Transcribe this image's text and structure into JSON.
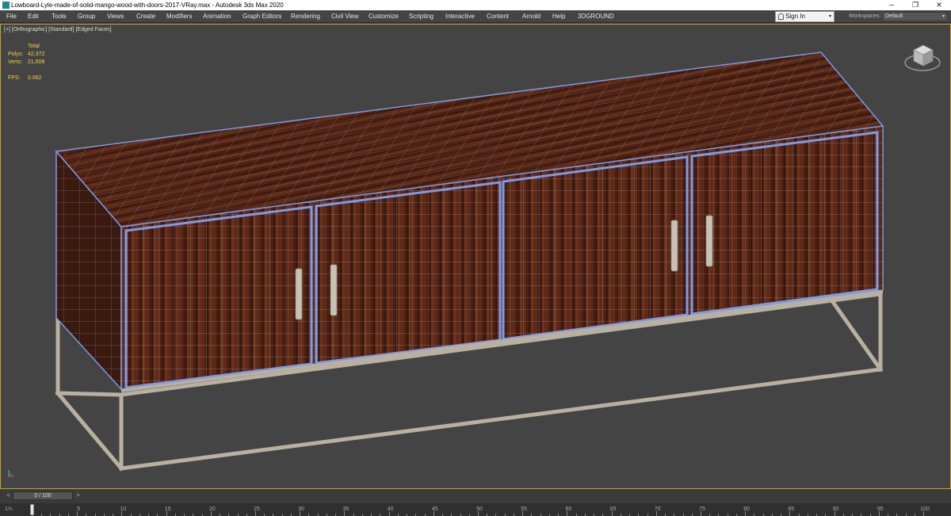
{
  "window": {
    "title": "Lowboard-Lyle-made-of-solid-mango-wood-with-doors-2017-VRay.max - Autodesk 3ds Max 2020",
    "minimize": "─",
    "restore": "❐",
    "close": "✕"
  },
  "menu": [
    "File",
    "Edit",
    "Tools",
    "Group",
    "Views",
    "Create",
    "Modifiers",
    "Animation",
    "Graph Editors",
    "Rendering",
    "Civil View",
    "Customize",
    "Scripting",
    "Interactive",
    "Content",
    "Arnold",
    "Help",
    "3DGROUND"
  ],
  "signin": {
    "label": "Sign In",
    "caret": "▾"
  },
  "workspaces": {
    "label": "Workspaces:",
    "value": "Default",
    "caret": "▾"
  },
  "viewport": {
    "label": "[+] [Orthographic] [Standard] [Edged Faces]",
    "stats": {
      "header": "Total",
      "polys_label": "Polys:",
      "polys": "42,372",
      "verts_label": "Verts:",
      "verts": "21,608",
      "fps_label": "FPS:",
      "fps": "0.062"
    },
    "viewcube_icon": "viewcube-icon"
  },
  "timeline": {
    "slider": "0 / 100",
    "prev": "<",
    "next": ">",
    "corner": "1⅓",
    "ticks": [
      "0",
      "5",
      "10",
      "15",
      "20",
      "25",
      "30",
      "35",
      "40",
      "45",
      "50",
      "55",
      "60",
      "65",
      "70",
      "75",
      "80",
      "85",
      "90",
      "95",
      "100"
    ]
  },
  "colors": {
    "viewport_bg": "#444444",
    "active_border": "#c9a227",
    "wood": "#5a2a1a",
    "wireframe": "#7d9ae6",
    "frame": "#b8b0a0",
    "stats": "#f4d03f"
  }
}
